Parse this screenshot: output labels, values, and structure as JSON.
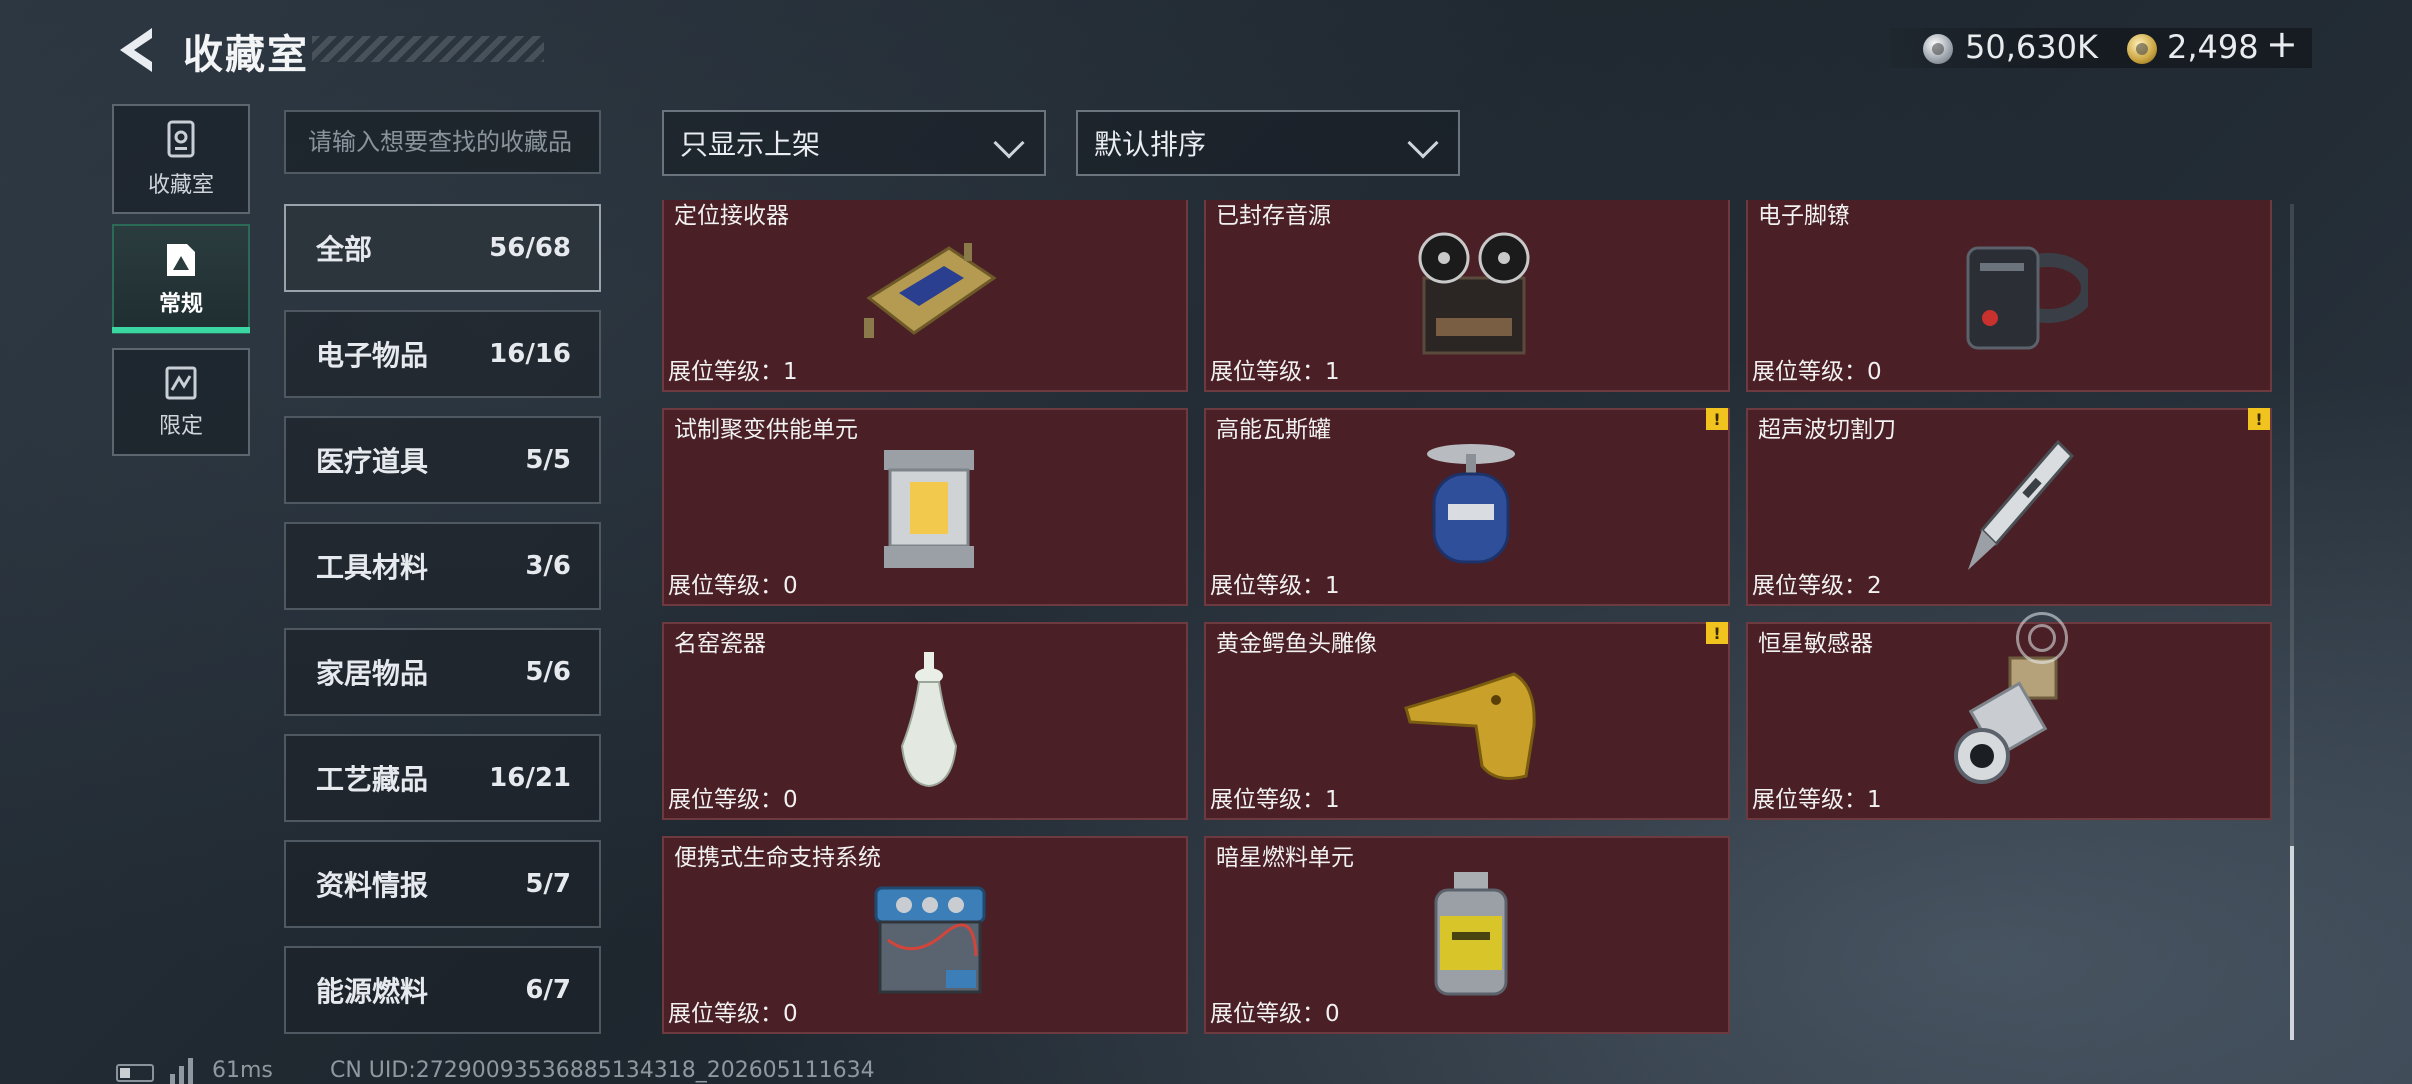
{
  "header": {
    "title": "收藏室",
    "currency_silver": "50,630K",
    "currency_gold": "2,498",
    "gold_plus": "+"
  },
  "rail": {
    "collection_label": "收藏室",
    "regular_label": "常规",
    "limited_label": "限定"
  },
  "search": {
    "placeholder": "请输入想要查找的收藏品"
  },
  "filters": {
    "filter_value": "只显示上架",
    "sort_value": "默认排序"
  },
  "categories": [
    {
      "name": "全部",
      "count": "56/68"
    },
    {
      "name": "电子物品",
      "count": "16/16"
    },
    {
      "name": "医疗道具",
      "count": "5/5"
    },
    {
      "name": "工具材料",
      "count": "3/6"
    },
    {
      "name": "家居物品",
      "count": "5/6"
    },
    {
      "name": "工艺藏品",
      "count": "16/21"
    },
    {
      "name": "资料情报",
      "count": "5/7"
    },
    {
      "name": "能源燃料",
      "count": "6/7"
    }
  ],
  "items": [
    {
      "name": "定位接收器",
      "level": "展位等级：1",
      "badge": ""
    },
    {
      "name": "已封存音源",
      "level": "展位等级：1",
      "badge": ""
    },
    {
      "name": "电子脚镣",
      "level": "展位等级：0",
      "badge": ""
    },
    {
      "name": "试制聚变供能单元",
      "level": "展位等级：0",
      "badge": ""
    },
    {
      "name": "高能瓦斯罐",
      "level": "展位等级：1",
      "badge": "!"
    },
    {
      "name": "超声波切割刀",
      "level": "展位等级：2",
      "badge": "!"
    },
    {
      "name": "名窑瓷器",
      "level": "展位等级：0",
      "badge": ""
    },
    {
      "name": "黄金鳄鱼头雕像",
      "level": "展位等级：1",
      "badge": "!"
    },
    {
      "name": "恒星敏感器",
      "level": "展位等级：1",
      "badge": ""
    },
    {
      "name": "便携式生命支持系统",
      "level": "展位等级：0",
      "badge": ""
    },
    {
      "name": "暗星燃料单元",
      "level": "展位等级：0",
      "badge": ""
    }
  ],
  "footer": {
    "ping": "61ms",
    "uid": "CN UID:27290093536885134318_202605111634"
  },
  "colors": {
    "card_bg": "#4a1f25",
    "accent_green": "#3ad7a3",
    "warning_badge": "#f0c31f"
  }
}
